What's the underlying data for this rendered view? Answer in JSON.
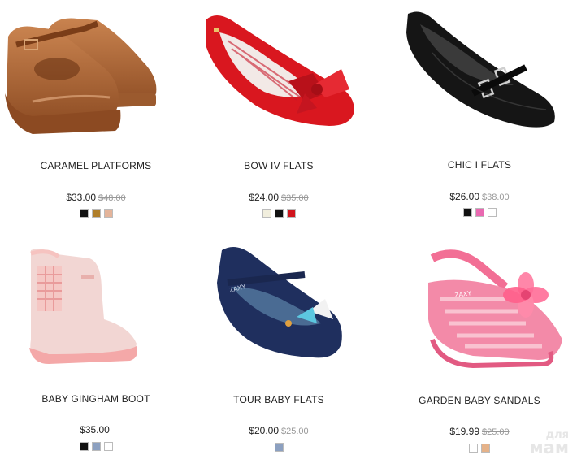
{
  "products": [
    {
      "name": "CARAMEL PLATFORMS",
      "price": "$33.00",
      "old_price": "$48.00",
      "swatches": [
        "#111111",
        "#b07f2a",
        "#e4b49a"
      ]
    },
    {
      "name": "BOW IV FLATS",
      "price": "$24.00",
      "old_price": "$35.00",
      "swatches": [
        "#f1eedd",
        "#111111",
        "#d0141c"
      ]
    },
    {
      "name": "CHIC I FLATS",
      "price": "$26.00",
      "old_price": "$38.00",
      "swatches": [
        "#111111",
        "#e969b1",
        "#ffffff"
      ]
    },
    {
      "name": "BABY GINGHAM BOOT",
      "price": "$35.00",
      "old_price": "",
      "swatches": [
        "#111111",
        "#8ca0c0",
        "#ffffff"
      ]
    },
    {
      "name": "TOUR BABY FLATS",
      "price": "$20.00",
      "old_price": "$25.00",
      "swatches": [
        "#8ca0c0"
      ]
    },
    {
      "name": "GARDEN BABY SANDALS",
      "price": "$19.99",
      "old_price": "$25.00",
      "swatches": [
        "#ffffff",
        "#e5b289"
      ]
    }
  ],
  "watermark": {
    "line1": "для",
    "line2": "мам"
  }
}
